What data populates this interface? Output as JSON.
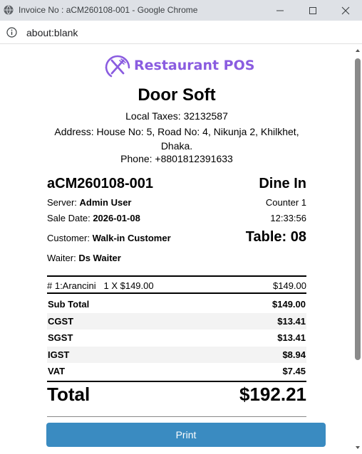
{
  "window": {
    "title": "Invoice No : aCM260108-001 - Google Chrome",
    "url": "about:blank"
  },
  "receipt": {
    "brand": "Restaurant POS",
    "company": "Door Soft",
    "taxes": "Local Taxes: 32132587",
    "address": "Address: House No: 5, Road No: 4, Nikunja 2, Khilkhet, Dhaka.",
    "phone": "Phone: +8801812391633",
    "invoice_no": "aCM260108-001",
    "order_type": "Dine In",
    "server_label": "Server:",
    "server": "Admin User",
    "counter": "Counter 1",
    "date_label": "Sale Date:",
    "date": "2026-01-08",
    "time": "12:33:56",
    "customer_label": "Customer:",
    "customer": "Walk-in Customer",
    "table": "Table: 08",
    "waiter_label": "Waiter:",
    "waiter": "Ds Waiter",
    "items": [
      {
        "desc": "# 1:Arancini   1 X $149.00",
        "amount": "$149.00"
      }
    ],
    "summary": [
      {
        "label": "Sub Total",
        "value": "$149.00"
      },
      {
        "label": "CGST",
        "value": "$13.41"
      },
      {
        "label": "SGST",
        "value": "$13.41"
      },
      {
        "label": "IGST",
        "value": "$8.94"
      },
      {
        "label": "VAT",
        "value": "$7.45"
      }
    ],
    "total_label": "Total",
    "total": "$192.21"
  },
  "actions": {
    "print_label": "Print"
  },
  "colors": {
    "brand": "#8a5ce0",
    "button": "#3a8bc1",
    "chrome": "#dee1e6"
  }
}
